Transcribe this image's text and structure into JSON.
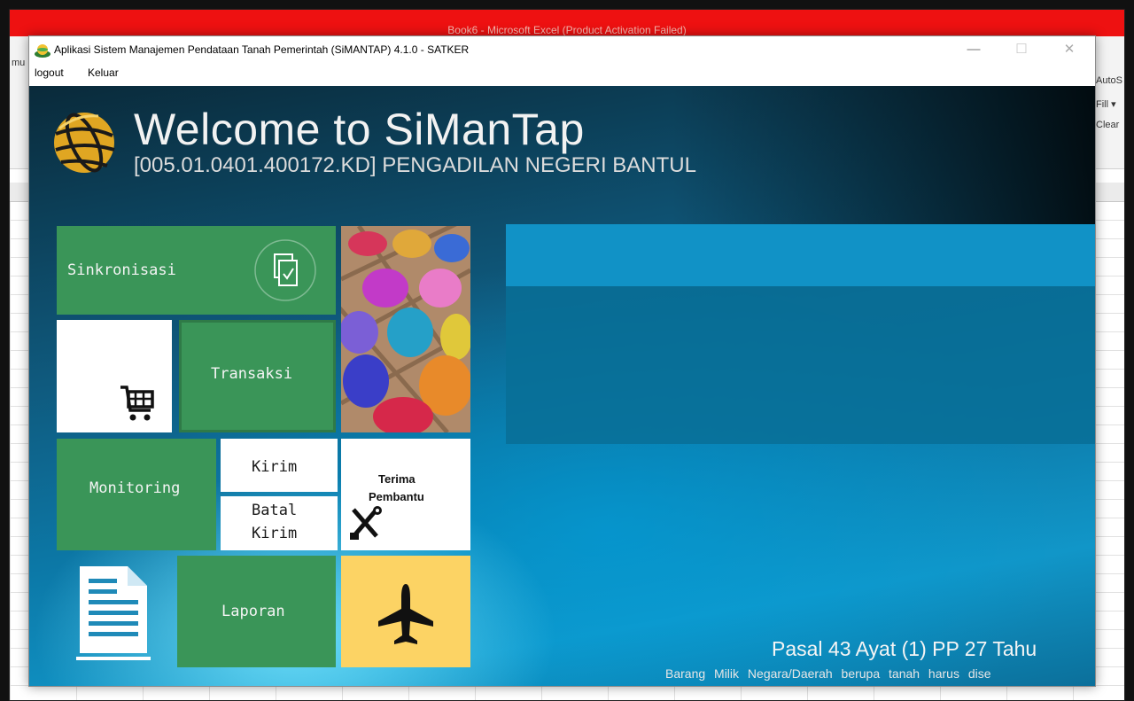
{
  "excel": {
    "title": "Book6 - Microsoft Excel (Product Activation Failed)",
    "ribbon_left": "mu",
    "ribbon_right": [
      "AutoS",
      "Fill ▾",
      "Clear"
    ]
  },
  "window": {
    "title": "Aplikasi Sistem Manajemen Pendataan Tanah Pemerintah (SiMANTAP) 4.1.0  - SATKER",
    "minimize": "—",
    "maximize": "☐",
    "close": "✕"
  },
  "menu": [
    "logout",
    "Keluar"
  ],
  "header": {
    "welcome": "Welcome to SiManTap",
    "org": "[005.01.0401.400172.KD] PENGADILAN NEGERI BANTUL"
  },
  "tiles": {
    "sinkronisasi": "Sinkronisasi",
    "transaksi": "Transaksi",
    "monitoring": "Monitoring",
    "kirim": "Kirim",
    "batal_kirim": [
      "Batal",
      "Kirim"
    ],
    "terima_pembantu": [
      "Terima",
      "Pembantu"
    ],
    "laporan": "Laporan"
  },
  "law": {
    "title": "Pasal 43 Ayat (1) PP 27 Tahu",
    "subtitle": "Barang Milik Negara/Daerah berupa tanah harus dise"
  },
  "colors": {
    "tile_green": "#3a9558",
    "tile_yellow": "#fcd364",
    "panel_blue": "#1192c6"
  },
  "icons": [
    "copy-check-icon",
    "shopping-cart-icon",
    "wrench-screwdriver-icon",
    "document-icon",
    "airplane-icon",
    "globe-logo"
  ]
}
